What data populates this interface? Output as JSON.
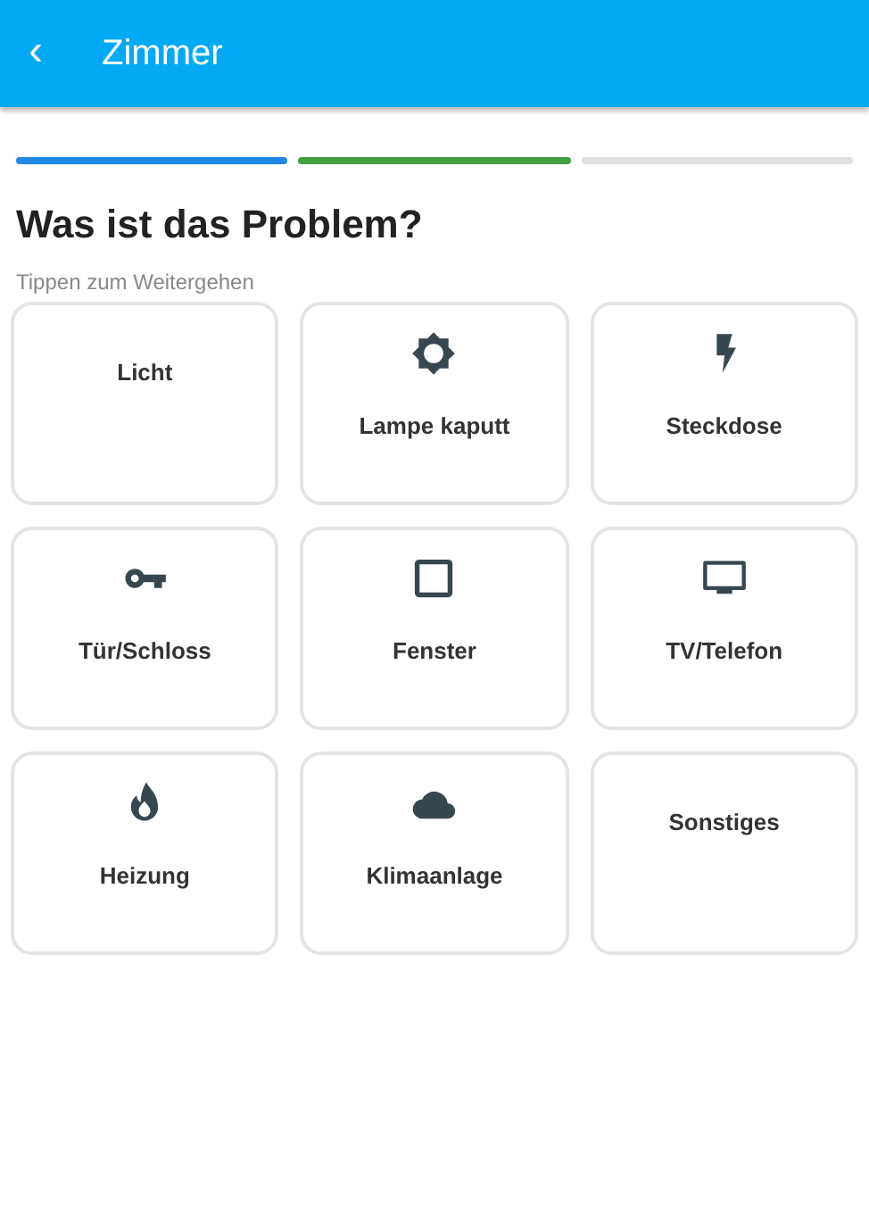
{
  "app_bar": {
    "back": "‹",
    "title": "Zimmer"
  },
  "steps": [
    {
      "color": "#1e88e5"
    },
    {
      "color": "#43a047"
    },
    {
      "color": "#e0e0e0"
    }
  ],
  "heading": "Was ist das Problem?",
  "hint": "Tippen zum Weitergehen",
  "tiles": [
    {
      "kind": "text",
      "label": "Licht"
    },
    {
      "kind": "sun",
      "label": "Lampe kaputt"
    },
    {
      "kind": "bolt",
      "label": "Steckdose"
    },
    {
      "kind": "key",
      "label": "Tür/Schloss"
    },
    {
      "kind": "square",
      "label": "Fenster"
    },
    {
      "kind": "tv",
      "label": "TV/Telefon"
    },
    {
      "kind": "fire",
      "label": "Heizung"
    },
    {
      "kind": "cloud",
      "label": "Klimaanlage"
    },
    {
      "kind": "text",
      "label": "Sonstiges"
    }
  ]
}
